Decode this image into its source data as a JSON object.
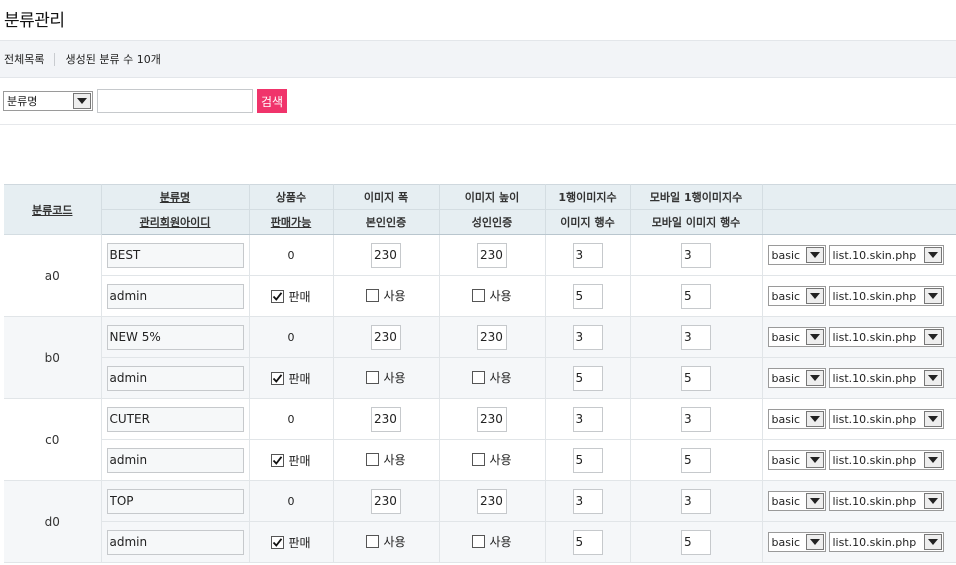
{
  "page_title": "분류관리",
  "summary": {
    "all_label": "전체목록",
    "count_text": "생성된 분류 수 10개"
  },
  "search": {
    "field_selected": "분류명",
    "input_value": "",
    "button_label": "검색"
  },
  "table": {
    "headers": {
      "code": "분류코드",
      "name": "분류명",
      "admin_id": "관리회원아이디",
      "product_count": "상품수",
      "sale_available": "판매가능",
      "image_width": "이미지 폭",
      "identity_check": "본인인증",
      "image_height": "이미지 높이",
      "adult_check": "성인인증",
      "images_per_row": "1행이미지수",
      "image_rows": "이미지 행수",
      "mobile_images_per_row": "모바일 1행이미지수",
      "mobile_image_rows": "모바일 이미지 행수"
    },
    "rows": [
      {
        "code": "a0",
        "name": "BEST",
        "admin_id": "admin",
        "product_count": "0",
        "sale_label": "판매",
        "sale_checked": true,
        "image_width": "230",
        "image_height": "230",
        "identity_label": "사용",
        "identity_checked": false,
        "adult_label": "사용",
        "adult_checked": false,
        "images_per_row": "3",
        "image_rows": "5",
        "mobile_images_per_row": "3",
        "mobile_image_rows": "5",
        "skin_top": "basic",
        "skin_file_top": "list.10.skin.php",
        "skin_bottom": "basic",
        "skin_file_bottom": "list.10.skin.php"
      },
      {
        "code": "b0",
        "name": "NEW 5%",
        "admin_id": "admin",
        "product_count": "0",
        "sale_label": "판매",
        "sale_checked": true,
        "image_width": "230",
        "image_height": "230",
        "identity_label": "사용",
        "identity_checked": false,
        "adult_label": "사용",
        "adult_checked": false,
        "images_per_row": "3",
        "image_rows": "5",
        "mobile_images_per_row": "3",
        "mobile_image_rows": "5",
        "skin_top": "basic",
        "skin_file_top": "list.10.skin.php",
        "skin_bottom": "basic",
        "skin_file_bottom": "list.10.skin.php"
      },
      {
        "code": "c0",
        "name": "CUTER",
        "admin_id": "admin",
        "product_count": "0",
        "sale_label": "판매",
        "sale_checked": true,
        "image_width": "230",
        "image_height": "230",
        "identity_label": "사용",
        "identity_checked": false,
        "adult_label": "사용",
        "adult_checked": false,
        "images_per_row": "3",
        "image_rows": "5",
        "mobile_images_per_row": "3",
        "mobile_image_rows": "5",
        "skin_top": "basic",
        "skin_file_top": "list.10.skin.php",
        "skin_bottom": "basic",
        "skin_file_bottom": "list.10.skin.php"
      },
      {
        "code": "d0",
        "name": "TOP",
        "admin_id": "admin",
        "product_count": "0",
        "sale_label": "판매",
        "sale_checked": true,
        "image_width": "230",
        "image_height": "230",
        "identity_label": "사용",
        "identity_checked": false,
        "adult_label": "사용",
        "adult_checked": false,
        "images_per_row": "3",
        "image_rows": "5",
        "mobile_images_per_row": "3",
        "mobile_image_rows": "5",
        "skin_top": "basic",
        "skin_file_top": "list.10.skin.php",
        "skin_bottom": "basic",
        "skin_file_bottom": "list.10.skin.php"
      }
    ]
  }
}
